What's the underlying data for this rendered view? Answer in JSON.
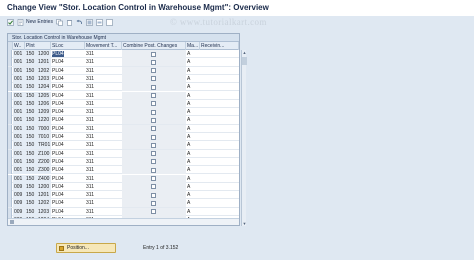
{
  "header": {
    "title": "Change View \"Stor. Location Control in Warehouse Mgmt\": Overview",
    "watermark": "© www.tutorialkart.com"
  },
  "toolbar": {
    "items": [
      {
        "label": "",
        "icon": "check-icon"
      },
      {
        "label": "New Entries",
        "icon": "new-entries-icon"
      },
      {
        "label": "",
        "icon": "copy-icon"
      },
      {
        "label": "",
        "icon": "delete-icon"
      },
      {
        "label": "",
        "icon": "undo-icon"
      },
      {
        "label": "",
        "icon": "select-all-icon"
      },
      {
        "label": "",
        "icon": "select-block-icon"
      },
      {
        "label": "",
        "icon": "deselect-icon"
      }
    ]
  },
  "table": {
    "title": "Stor. Location Control in Warehouse Mgmt",
    "columns": [
      "W..",
      "Plnt",
      "SLoc",
      "Movement T...",
      "Combine Post. Changes",
      "Ma...",
      "Receivin..."
    ],
    "rows": [
      {
        "w": "001",
        "plnt": "150",
        "plnt2": "1200",
        "sloc": "PL04",
        "mvt": "311",
        "combine": false,
        "ma": "A"
      },
      {
        "w": "001",
        "plnt": "150",
        "plnt2": "1201",
        "sloc": "PL04",
        "mvt": "311",
        "combine": false,
        "ma": "A"
      },
      {
        "w": "001",
        "plnt": "150",
        "plnt2": "1202",
        "sloc": "PL04",
        "mvt": "311",
        "combine": false,
        "ma": "A"
      },
      {
        "w": "001",
        "plnt": "150",
        "plnt2": "1203",
        "sloc": "PL04",
        "mvt": "311",
        "combine": false,
        "ma": "A"
      },
      {
        "w": "001",
        "plnt": "150",
        "plnt2": "1204",
        "sloc": "PL04",
        "mvt": "311",
        "combine": false,
        "ma": "A"
      },
      {
        "w": "001",
        "plnt": "150",
        "plnt2": "1205",
        "sloc": "PL04",
        "mvt": "311",
        "combine": false,
        "ma": "A"
      },
      {
        "w": "001",
        "plnt": "150",
        "plnt2": "1206",
        "sloc": "PL04",
        "mvt": "311",
        "combine": false,
        "ma": "A"
      },
      {
        "w": "001",
        "plnt": "150",
        "plnt2": "1209",
        "sloc": "PL04",
        "mvt": "311",
        "combine": false,
        "ma": "A"
      },
      {
        "w": "001",
        "plnt": "150",
        "plnt2": "1220",
        "sloc": "PL04",
        "mvt": "311",
        "combine": false,
        "ma": "A"
      },
      {
        "w": "001",
        "plnt": "150",
        "plnt2": "7000",
        "sloc": "PL04",
        "mvt": "311",
        "combine": false,
        "ma": "A"
      },
      {
        "w": "001",
        "plnt": "150",
        "plnt2": "7010",
        "sloc": "PL04",
        "mvt": "311",
        "combine": false,
        "ma": "A"
      },
      {
        "w": "001",
        "plnt": "150",
        "plnt2": "TR01",
        "sloc": "PL04",
        "mvt": "311",
        "combine": false,
        "ma": "A"
      },
      {
        "w": "001",
        "plnt": "150",
        "plnt2": "Z100",
        "sloc": "PL04",
        "mvt": "311",
        "combine": false,
        "ma": "A"
      },
      {
        "w": "001",
        "plnt": "150",
        "plnt2": "Z200",
        "sloc": "PL04",
        "mvt": "311",
        "combine": false,
        "ma": "A"
      },
      {
        "w": "001",
        "plnt": "150",
        "plnt2": "Z300",
        "sloc": "PL04",
        "mvt": "311",
        "combine": false,
        "ma": "A"
      },
      {
        "w": "001",
        "plnt": "150",
        "plnt2": "Z400",
        "sloc": "PL04",
        "mvt": "311",
        "combine": false,
        "ma": "A"
      },
      {
        "w": "009",
        "plnt": "150",
        "plnt2": "1200",
        "sloc": "PL04",
        "mvt": "311",
        "combine": false,
        "ma": "A"
      },
      {
        "w": "009",
        "plnt": "150",
        "plnt2": "1201",
        "sloc": "PL04",
        "mvt": "311",
        "combine": false,
        "ma": "A"
      },
      {
        "w": "009",
        "plnt": "150",
        "plnt2": "1202",
        "sloc": "PL04",
        "mvt": "311",
        "combine": false,
        "ma": "A"
      },
      {
        "w": "009",
        "plnt": "150",
        "plnt2": "1203",
        "sloc": "PL04",
        "mvt": "311",
        "combine": false,
        "ma": "A"
      },
      {
        "w": "009",
        "plnt": "150",
        "plnt2": "1204",
        "sloc": "PL04",
        "mvt": "311",
        "combine": false,
        "ma": "A"
      }
    ]
  },
  "footer": {
    "position_button": "Position...",
    "entry_info": "Entry 1 of 3.152"
  },
  "colors": {
    "accent": "#3d5b8a",
    "background": "#dfe8f2",
    "button": "#f6e7b8"
  }
}
